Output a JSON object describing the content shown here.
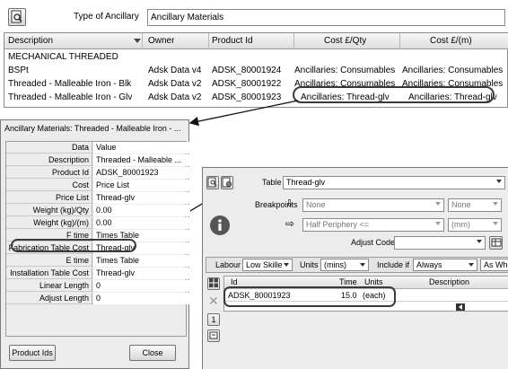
{
  "top": {
    "type_label": "Type of Ancillary",
    "type_value": "Ancillary Materials",
    "columns": [
      "Description",
      "Owner",
      "Product Id",
      "Cost £/Qty",
      "Cost £/(m)"
    ],
    "group": "MECHANICAL THREADED",
    "rows": [
      {
        "desc": "BSPt",
        "owner": "Adsk Data v4",
        "pid": "ADSK_80001924",
        "qty": "Ancillaries: Consumables",
        "m": "Ancillaries: Consumables"
      },
      {
        "desc": "Threaded - Malleable Iron - Blk",
        "owner": "Adsk Data v2",
        "pid": "ADSK_80001922",
        "qty": "Ancillaries: Consumables",
        "m": "Ancillaries: Consumables"
      },
      {
        "desc": "Threaded - Malleable Iron - Glv",
        "owner": "Adsk Data v2",
        "pid": "ADSK_80001923",
        "qty": "Ancillaries: Thread-glv",
        "m": "Ancillaries: Thread-glv"
      }
    ]
  },
  "dialog": {
    "title": "Ancillary Materials: Threaded - Malleable Iron - ...",
    "header": {
      "label": "Data",
      "value": "Value"
    },
    "rows": [
      {
        "label": "Description",
        "value": "Threaded - Malleable ..."
      },
      {
        "label": "Product Id",
        "value": "ADSK_80001923"
      },
      {
        "label": "Cost",
        "value": "Price List"
      },
      {
        "label": "Price List",
        "value": "Thread-glv"
      },
      {
        "label": "Weight (kg)/Qty",
        "value": "0.00"
      },
      {
        "label": "Weight (kg)/(m)",
        "value": "0.00"
      },
      {
        "label": "F time",
        "value": "Times Table"
      },
      {
        "label": "Fabrication Table Cost",
        "value": "Thread-glv"
      },
      {
        "label": "E time",
        "value": "Times Table"
      },
      {
        "label": "Installation Table Cost",
        "value": "Thread-glv"
      },
      {
        "label": "Linear Length",
        "value": "0"
      },
      {
        "label": "Adjust Length",
        "value": "0"
      }
    ],
    "product_ids_btn": "Product Ids",
    "close_btn": "Close"
  },
  "table_panel": {
    "table_label": "Table",
    "table_value": "Thread-glv",
    "breakpoints_label": "Breakpoints",
    "bp1_value": "None",
    "bp1_unit": "None",
    "bp2_value": "Half Periphery <=",
    "bp2_unit": "(mm)",
    "adjust_code_label": "Adjust Code",
    "labour_label": "Labour",
    "labour_value": "Low Skille",
    "units_label": "Units",
    "units_value": "(mins)",
    "include_label": "Include if",
    "include_value": "Always",
    "as_whole_value": "As Whol",
    "grid_columns": [
      "Id",
      "Time",
      "Units",
      "Description"
    ],
    "grid_row": {
      "id": "ADSK_80001923",
      "time": "15.0",
      "units": "(each)",
      "description": ""
    },
    "nav_number": "1"
  },
  "colors": {
    "highlight_ring": "#3a3a3a",
    "dialog_bg": "#ececec"
  }
}
